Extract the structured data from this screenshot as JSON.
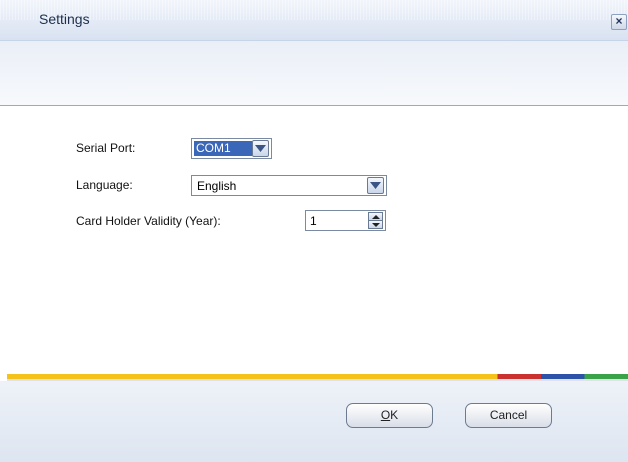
{
  "window": {
    "title": "Settings",
    "close_label": "×"
  },
  "form": {
    "serial_port": {
      "label": "Serial Port:",
      "value": "COM1"
    },
    "language": {
      "label": "Language:",
      "value": "English"
    },
    "validity": {
      "label": "Card Holder Validity (Year):",
      "value": "1"
    }
  },
  "footer": {
    "ok_first": "O",
    "ok_rest": "K",
    "cancel_label": "Cancel"
  },
  "colors": {
    "stripe": [
      "#f4c21b",
      "#c9322e",
      "#2d53a8",
      "#3aa34a"
    ],
    "selection": "#3a67b8"
  }
}
